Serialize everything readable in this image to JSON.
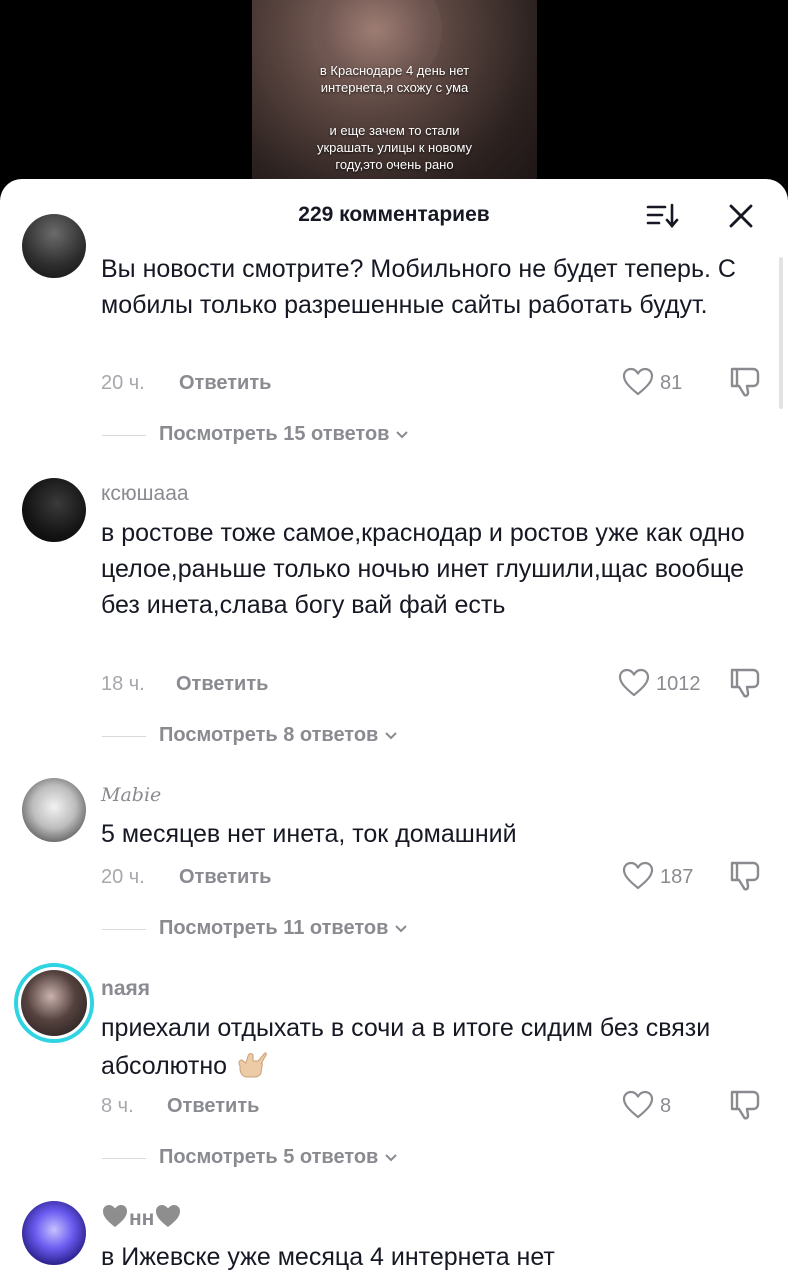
{
  "video": {
    "caption_1": "в Краснодаре 4 день нет\nинтернета,я схожу с ума",
    "caption_2": "и еще зачем то стали\nукрашать улицы к новому\nгоду,это очень рано"
  },
  "sheet": {
    "title": "229 комментариев",
    "sort_icon": "sort-icon",
    "close_icon": "close-icon"
  },
  "comments": [
    {
      "username": "",
      "text": "Вы новости смотрите? Мобильного не будет теперь. С мобилы только разрешенные сайты работать будут.",
      "time": "20 ч.",
      "reply_label": "Ответить",
      "likes": "81",
      "view_replies": "Посмотреть 15 ответов"
    },
    {
      "username": "ксюшааа",
      "text": "в ростове тоже самое,краснодар и ростов уже как одно целое,раньше только ночью инет глушили,щас вообще без инета,слава богу вай фай есть",
      "time": "18 ч.",
      "reply_label": "Ответить",
      "likes": "1012",
      "view_replies": "Посмотреть 8 ответов"
    },
    {
      "username": "Mabie",
      "text": "5 месяцев нет инета, ток домашний",
      "time": "20 ч.",
      "reply_label": "Ответить",
      "likes": "187",
      "view_replies": "Посмотреть 11 ответов"
    },
    {
      "username": "naяя",
      "text": "приехали отдыхать в сочи а в итоге сидим без связи абсолютно",
      "time": "8 ч.",
      "reply_label": "Ответить",
      "likes": "8",
      "view_replies": "Посмотреть 5 ответов"
    },
    {
      "username": "нн",
      "text": "в Ижевске уже месяца 4 интернета нет"
    }
  ],
  "colors": {
    "accent_ring": "#2fd4e3",
    "text_primary": "#161823",
    "text_secondary": "#8a8b91"
  }
}
